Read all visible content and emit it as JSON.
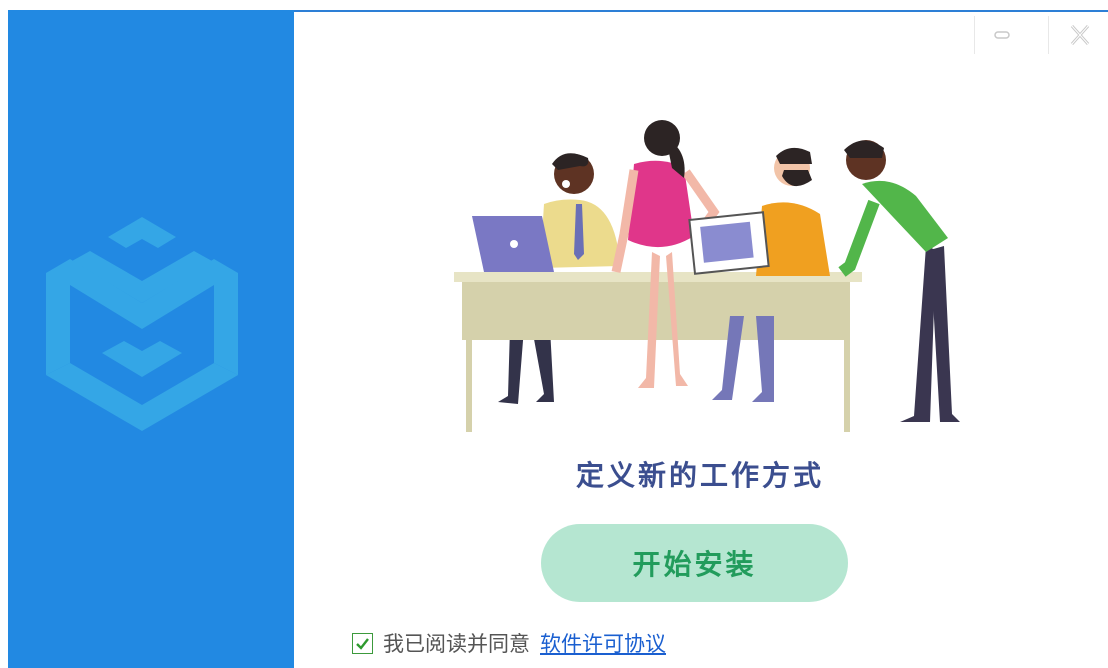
{
  "window": {
    "minimize_icon": "minimize-icon",
    "close_icon": "close-icon"
  },
  "sidebar": {
    "color": "#2289e2",
    "logo_icon": "cube-m-logo"
  },
  "main": {
    "illustration": "team-meeting-illustration",
    "tagline": "定义新的工作方式",
    "install_button": "开始安装",
    "install_button_bg": "#b5e6d1",
    "install_button_text_color": "#229c5c"
  },
  "agreement": {
    "checked": true,
    "text": "我已阅读并同意",
    "link": "软件许可协议"
  }
}
